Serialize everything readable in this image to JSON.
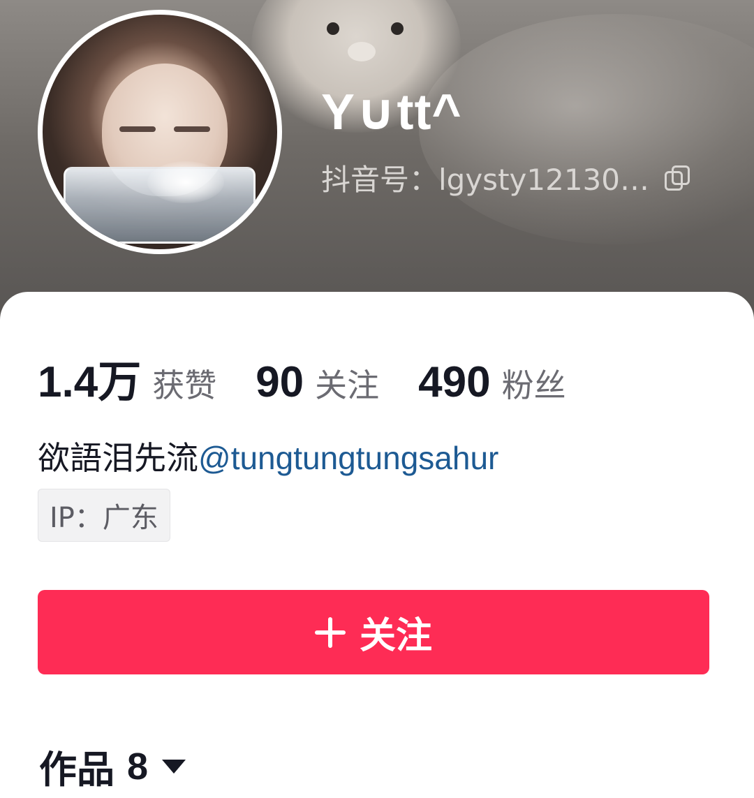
{
  "profile": {
    "nickname": "Y∪tt^",
    "douyin_id": "抖音号：lgysty12130…",
    "bio_text": "欲語泪先流",
    "bio_mention": "@tungtungtungsahur",
    "ip_location": "IP：广东"
  },
  "stats": [
    {
      "value": "1.4万",
      "label": "获赞"
    },
    {
      "value": "90",
      "label": "关注"
    },
    {
      "value": "490",
      "label": "粉丝"
    }
  ],
  "follow_button": {
    "label": "关注",
    "color": "#fe2c55"
  },
  "works_tab": {
    "label": "作品",
    "count": "8"
  },
  "icons": {
    "copy": "copy-icon",
    "plus": "plus-icon",
    "caret": "caret-down-icon"
  }
}
